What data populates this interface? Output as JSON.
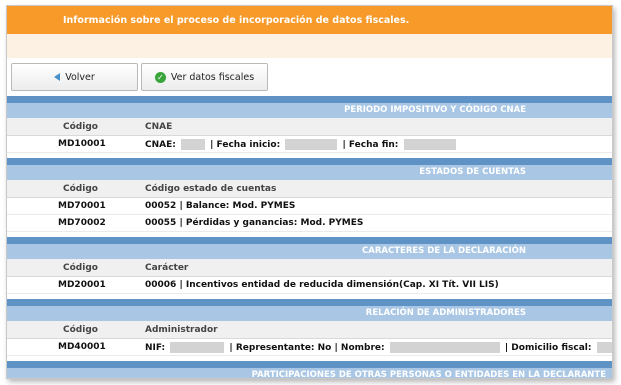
{
  "banner": {
    "text": "Información sobre el proceso de incorporación de datos fiscales."
  },
  "toolbar": {
    "back_label": "Volver",
    "view_label": "Ver datos fiscales"
  },
  "sections": [
    {
      "title": "PERIODO IMPOSITIVO Y CÓDIGO CNAE",
      "header": [
        "Código",
        "CNAE"
      ],
      "rows": [
        {
          "code": "MD10001",
          "parts": [
            "CNAE:",
            "| Fecha inicio:",
            "| Fecha fin:"
          ]
        }
      ]
    },
    {
      "title": "ESTADOS DE CUENTAS",
      "header": [
        "Código",
        "Código estado de cuentas"
      ],
      "rows": [
        {
          "code": "MD70001",
          "value": "00052 | Balance: Mod. PYMES"
        },
        {
          "code": "MD70002",
          "value": "00055 | Pérdidas y ganancias: Mod. PYMES"
        }
      ]
    },
    {
      "title": "CARACTERES DE LA DECLARACIÓN",
      "header": [
        "Código",
        "Carácter"
      ],
      "rows": [
        {
          "code": "MD20001",
          "value": "00006 | Incentivos entidad de reducida dimensión(Cap. XI Tít. VII LIS)"
        }
      ]
    },
    {
      "title": "RELACIÓN DE ADMINISTRADORES",
      "header": [
        "Código",
        "Administrador"
      ],
      "rows": [
        {
          "code": "MD40001",
          "parts": [
            "NIF:",
            "| Representante: No | Nombre:",
            "| Domicilio fiscal:"
          ]
        }
      ]
    },
    {
      "title": "PARTICIPACIONES DE OTRAS PERSONAS O ENTIDADES EN LA DECLARANTE"
    }
  ]
}
